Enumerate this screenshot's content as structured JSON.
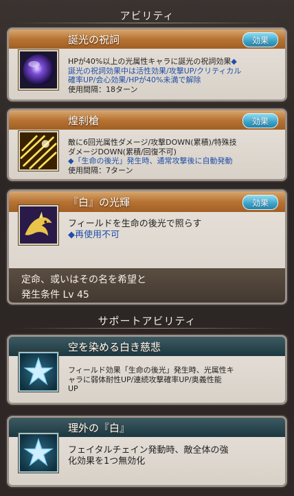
{
  "sections": {
    "abilities_title": "アビリティ",
    "support_title": "サポートアビリティ"
  },
  "abilities": [
    {
      "name": "誕光の祝詞",
      "badge": "効果",
      "icon": "purple-orb-icon",
      "line1": "HPが40%以上の光属性キャラに誕光の祝詞効果",
      "line1b": "◆",
      "line2": "誕光の祝詞効果中は活性効果/攻撃UP/クリティカル",
      "line3": "確率UP/会心効果/HPが40%未満で解除",
      "line4": "使用間隔：18ターン"
    },
    {
      "name": "煌刹槍",
      "badge": "効果",
      "icon": "light-lances-icon",
      "line1": "敵に6回光属性ダメージ/攻撃DOWN(累積)/特殊技",
      "line2": "ダメージDOWN(累積/回復不可)",
      "line3": "◆「生命の後光」発生時、通常攻撃後に自動発動",
      "line4": "使用間隔：7ターン"
    },
    {
      "name": "『白』の光輝",
      "badge": "効果",
      "icon": "white-dragon-icon",
      "line1": "フィールドを生命の後光で照らす",
      "line2": "◆再使用不可",
      "footer1": "定命、或いはその名を希望と",
      "footer2": "発生条件 Lv 45"
    }
  ],
  "support": [
    {
      "name": "空を染める白き慈悲",
      "icon": "star-icon",
      "line1": "フィールド効果「生命の後光」発生時、光属性キ",
      "line2": "ャラに弱体耐性UP/連続攻撃確率UP/奥義性能",
      "line3": "UP"
    },
    {
      "name": "理外の『白』",
      "icon": "star-icon",
      "line1": "フェイタルチェイン発動時、敵全体の強",
      "line2": "化効果を1つ無効化"
    }
  ]
}
